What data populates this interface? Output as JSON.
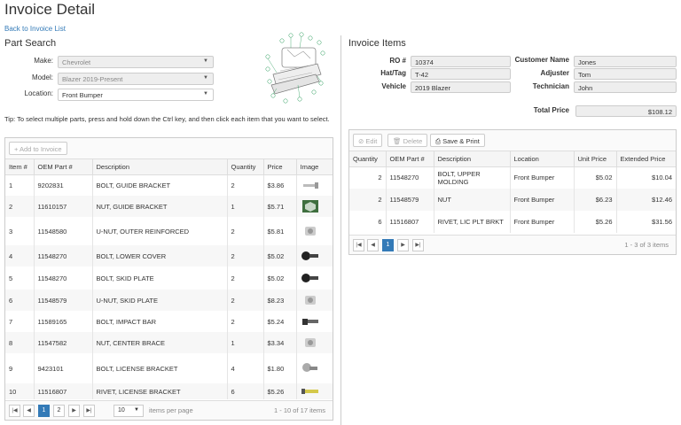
{
  "page": {
    "title": "Invoice Detail",
    "back_link": "Back to Invoice List"
  },
  "part_search": {
    "title": "Part Search",
    "make_label": "Make:",
    "make_value": "Chevrolet",
    "model_label": "Model:",
    "model_value": "Blazer 2019-Present",
    "location_label": "Location:",
    "location_value": "Front Bumper",
    "tip": "Tip: To select multiple parts, press and hold down the Ctrl key, and then click each item that you want to select.",
    "add_button": "+ Add to Invoice",
    "columns": [
      "Item #",
      "OEM Part #",
      "Description",
      "Quantity",
      "Price",
      "Image"
    ],
    "rows": [
      {
        "item": "1",
        "oem": "9202831",
        "desc": "BOLT, GUIDE BRACKET",
        "qty": "2",
        "price": "$3.86",
        "img": "bolt-long"
      },
      {
        "item": "2",
        "oem": "11610157",
        "desc": "NUT, GUIDE BRACKET",
        "qty": "1",
        "price": "$5.71",
        "img": "nut-green"
      },
      {
        "item": "3",
        "oem": "11548580",
        "desc": "U-NUT, OUTER REINFORCED",
        "qty": "2",
        "price": "$5.81",
        "img": "unut"
      },
      {
        "item": "4",
        "oem": "11548270",
        "desc": "BOLT, LOWER COVER",
        "qty": "2",
        "price": "$5.02",
        "img": "bolt-black"
      },
      {
        "item": "5",
        "oem": "11548270",
        "desc": "BOLT, SKID PLATE",
        "qty": "2",
        "price": "$5.02",
        "img": "bolt-black"
      },
      {
        "item": "6",
        "oem": "11548579",
        "desc": "U-NUT, SKID PLATE",
        "qty": "2",
        "price": "$8.23",
        "img": "unut"
      },
      {
        "item": "7",
        "oem": "11589165",
        "desc": "BOLT, IMPACT BAR",
        "qty": "2",
        "price": "$5.24",
        "img": "bolt-dark"
      },
      {
        "item": "8",
        "oem": "11547582",
        "desc": "NUT, CENTER BRACE",
        "qty": "1",
        "price": "$3.34",
        "img": "unut"
      },
      {
        "item": "9",
        "oem": "9423101",
        "desc": "BOLT, LICENSE BRACKET",
        "qty": "4",
        "price": "$1.80",
        "img": "bolt-silver"
      },
      {
        "item": "10",
        "oem": "11516807",
        "desc": "RIVET, LICENSE BRACKET",
        "qty": "6",
        "price": "$5.26",
        "img": "rivet"
      }
    ],
    "pager": {
      "pages": [
        "1",
        "2"
      ],
      "page_size": "10",
      "per_page_label": "items per page",
      "info": "1 - 10 of 17 items"
    }
  },
  "invoice": {
    "title": "Invoice Items",
    "ro_label": "RO #",
    "ro_value": "10374",
    "hat_label": "Hat/Tag",
    "hat_value": "T-42",
    "vehicle_label": "Vehicle",
    "vehicle_value": "2019 Blazer",
    "customer_label": "Customer Name",
    "customer_value": "Jones",
    "adjuster_label": "Adjuster",
    "adjuster_value": "Tom",
    "technician_label": "Technician",
    "technician_value": "John",
    "total_label": "Total Price",
    "total_value": "$108.12",
    "edit_button": "Edit",
    "delete_button": "Delete",
    "save_button": "Save & Print",
    "columns": [
      "Quantity",
      "OEM Part #",
      "Description",
      "Location",
      "Unit Price",
      "Extended Price"
    ],
    "rows": [
      {
        "qty": "2",
        "oem": "11548270",
        "desc": "BOLT, UPPER MOLDING",
        "loc": "Front Bumper",
        "unit": "$5.02",
        "ext": "$10.04"
      },
      {
        "qty": "2",
        "oem": "11548579",
        "desc": "NUT",
        "loc": "Front Bumper",
        "unit": "$6.23",
        "ext": "$12.46"
      },
      {
        "qty": "6",
        "oem": "11516807",
        "desc": "RIVET, LIC PLT BRKT",
        "loc": "Front Bumper",
        "unit": "$5.26",
        "ext": "$31.56"
      }
    ],
    "pager": {
      "pages": [
        "1"
      ],
      "info": "1 - 3 of 3 items"
    }
  },
  "colors": {
    "link": "#337ab7",
    "accent": "#337ab7",
    "diagram_callout": "#2a9d5c"
  }
}
